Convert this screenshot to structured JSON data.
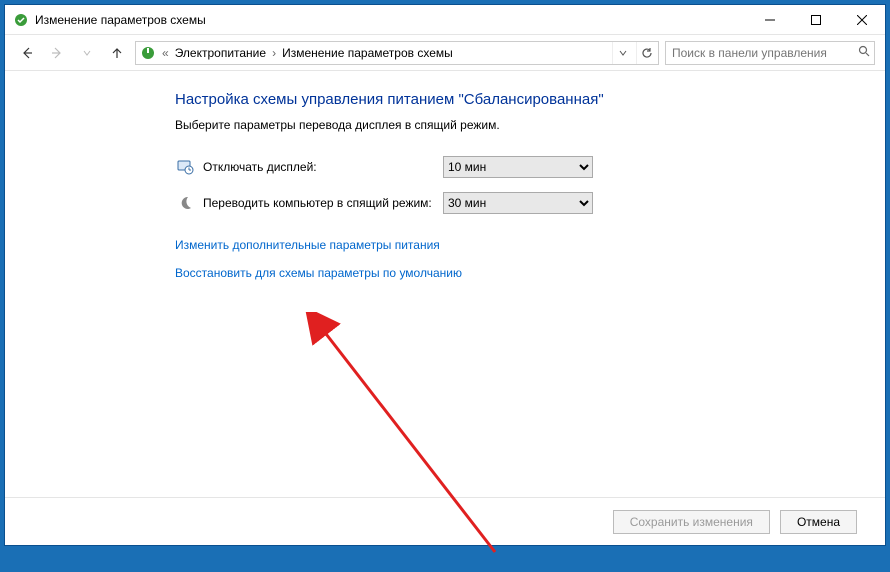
{
  "titlebar": {
    "title": "Изменение параметров схемы"
  },
  "breadcrumb": {
    "root_icon": "power-icon",
    "item1": "Электропитание",
    "item2": "Изменение параметров схемы"
  },
  "search": {
    "placeholder": "Поиск в панели управления"
  },
  "main": {
    "heading": "Настройка схемы управления питанием \"Сбалансированная\"",
    "subtext": "Выберите параметры перевода дисплея в спящий режим.",
    "rows": [
      {
        "icon": "monitor-timer-icon",
        "label": "Отключать дисплей:",
        "value": "10 мин"
      },
      {
        "icon": "moon-icon",
        "label": "Переводить компьютер в спящий режим:",
        "value": "30 мин"
      }
    ],
    "links": {
      "advanced": "Изменить дополнительные параметры питания",
      "restore": "Восстановить для схемы параметры по умолчанию"
    }
  },
  "footer": {
    "save": "Сохранить изменения",
    "cancel": "Отмена"
  }
}
